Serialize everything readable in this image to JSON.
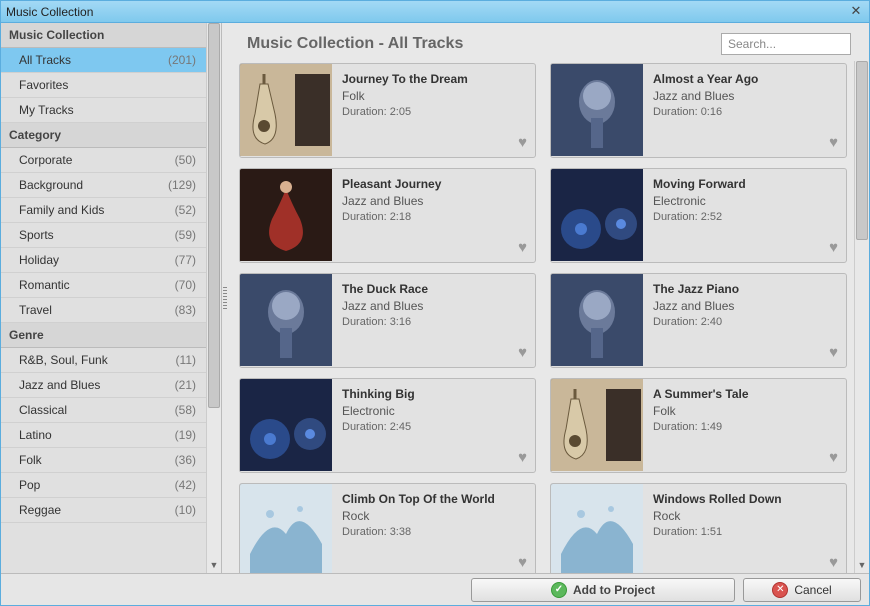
{
  "window": {
    "title": "Music Collection"
  },
  "sidebar": {
    "sections": [
      {
        "header": "Music Collection",
        "items": [
          {
            "label": "All Tracks",
            "count": "(201)",
            "selected": true
          },
          {
            "label": "Favorites",
            "count": ""
          },
          {
            "label": "My Tracks",
            "count": ""
          }
        ]
      },
      {
        "header": "Category",
        "items": [
          {
            "label": "Corporate",
            "count": "(50)"
          },
          {
            "label": "Background",
            "count": "(129)"
          },
          {
            "label": "Family and Kids",
            "count": "(52)"
          },
          {
            "label": "Sports",
            "count": "(59)"
          },
          {
            "label": "Holiday",
            "count": "(77)"
          },
          {
            "label": "Romantic",
            "count": "(70)"
          },
          {
            "label": "Travel",
            "count": "(83)"
          }
        ]
      },
      {
        "header": "Genre",
        "items": [
          {
            "label": "R&B, Soul, Funk",
            "count": "(11)"
          },
          {
            "label": "Jazz and Blues",
            "count": "(21)"
          },
          {
            "label": "Classical",
            "count": "(58)"
          },
          {
            "label": "Latino",
            "count": "(19)"
          },
          {
            "label": "Folk",
            "count": "(36)"
          },
          {
            "label": "Pop",
            "count": "(42)"
          },
          {
            "label": "Reggae",
            "count": "(10)"
          }
        ]
      }
    ]
  },
  "main": {
    "title": "Music Collection - All Tracks",
    "search_placeholder": "Search..."
  },
  "tracks": [
    {
      "title": "Journey To the Dream",
      "genre": "Folk",
      "duration": "Duration: 2:05",
      "art": "guitar"
    },
    {
      "title": "Almost a Year Ago",
      "genre": "Jazz and Blues",
      "duration": "Duration: 0:16",
      "art": "mic"
    },
    {
      "title": "Pleasant Journey",
      "genre": "Jazz and Blues",
      "duration": "Duration: 2:18",
      "art": "dancer"
    },
    {
      "title": "Moving Forward",
      "genre": "Electronic",
      "duration": "Duration: 2:52",
      "art": "dj"
    },
    {
      "title": "The Duck Race",
      "genre": "Jazz and Blues",
      "duration": "Duration: 3:16",
      "art": "mic"
    },
    {
      "title": "The Jazz Piano",
      "genre": "Jazz and Blues",
      "duration": "Duration: 2:40",
      "art": "mic"
    },
    {
      "title": "Thinking Big",
      "genre": "Electronic",
      "duration": "Duration: 2:45",
      "art": "dj"
    },
    {
      "title": "A Summer's Tale",
      "genre": "Folk",
      "duration": "Duration: 1:49",
      "art": "guitar"
    },
    {
      "title": "Climb On Top Of the World",
      "genre": "Rock",
      "duration": "Duration: 3:38",
      "art": "splash"
    },
    {
      "title": "Windows Rolled Down",
      "genre": "Rock",
      "duration": "Duration: 1:51",
      "art": "splash"
    }
  ],
  "footer": {
    "add": "Add to Project",
    "cancel": "Cancel"
  }
}
